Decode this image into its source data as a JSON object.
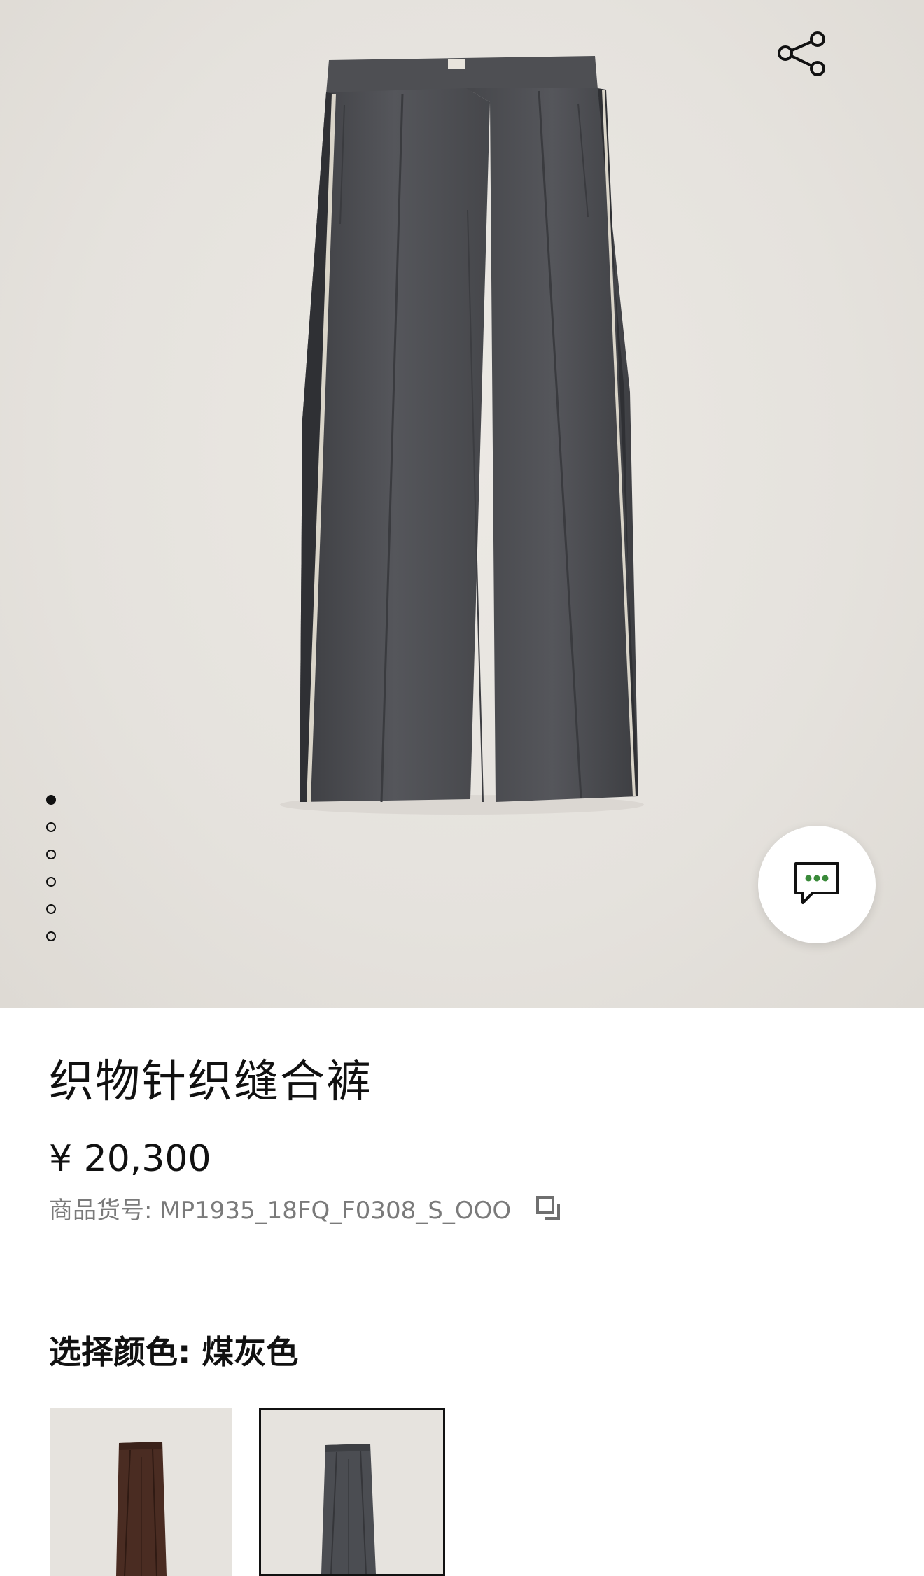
{
  "product": {
    "title": "织物针织缝合裤",
    "price": "¥ 20,300",
    "sku_label": "商品货号: MP1935_18FQ_F0308_S_OOO"
  },
  "color": {
    "label": "选择颜色: 煤灰色",
    "options": [
      {
        "name": "brown",
        "hex": "#4a2c22"
      },
      {
        "name": "charcoal",
        "hex": "#4b4d52",
        "selected": true
      }
    ]
  },
  "gallery": {
    "dot_count": 6,
    "active_index": 0
  },
  "icons": {
    "share": "share-icon",
    "chat": "chat-icon",
    "copy": "copy-icon"
  },
  "colors": {
    "hero_bg": "#e7e4df",
    "pants": "#4b4c50",
    "chat_dots": "#3a8a3a"
  }
}
